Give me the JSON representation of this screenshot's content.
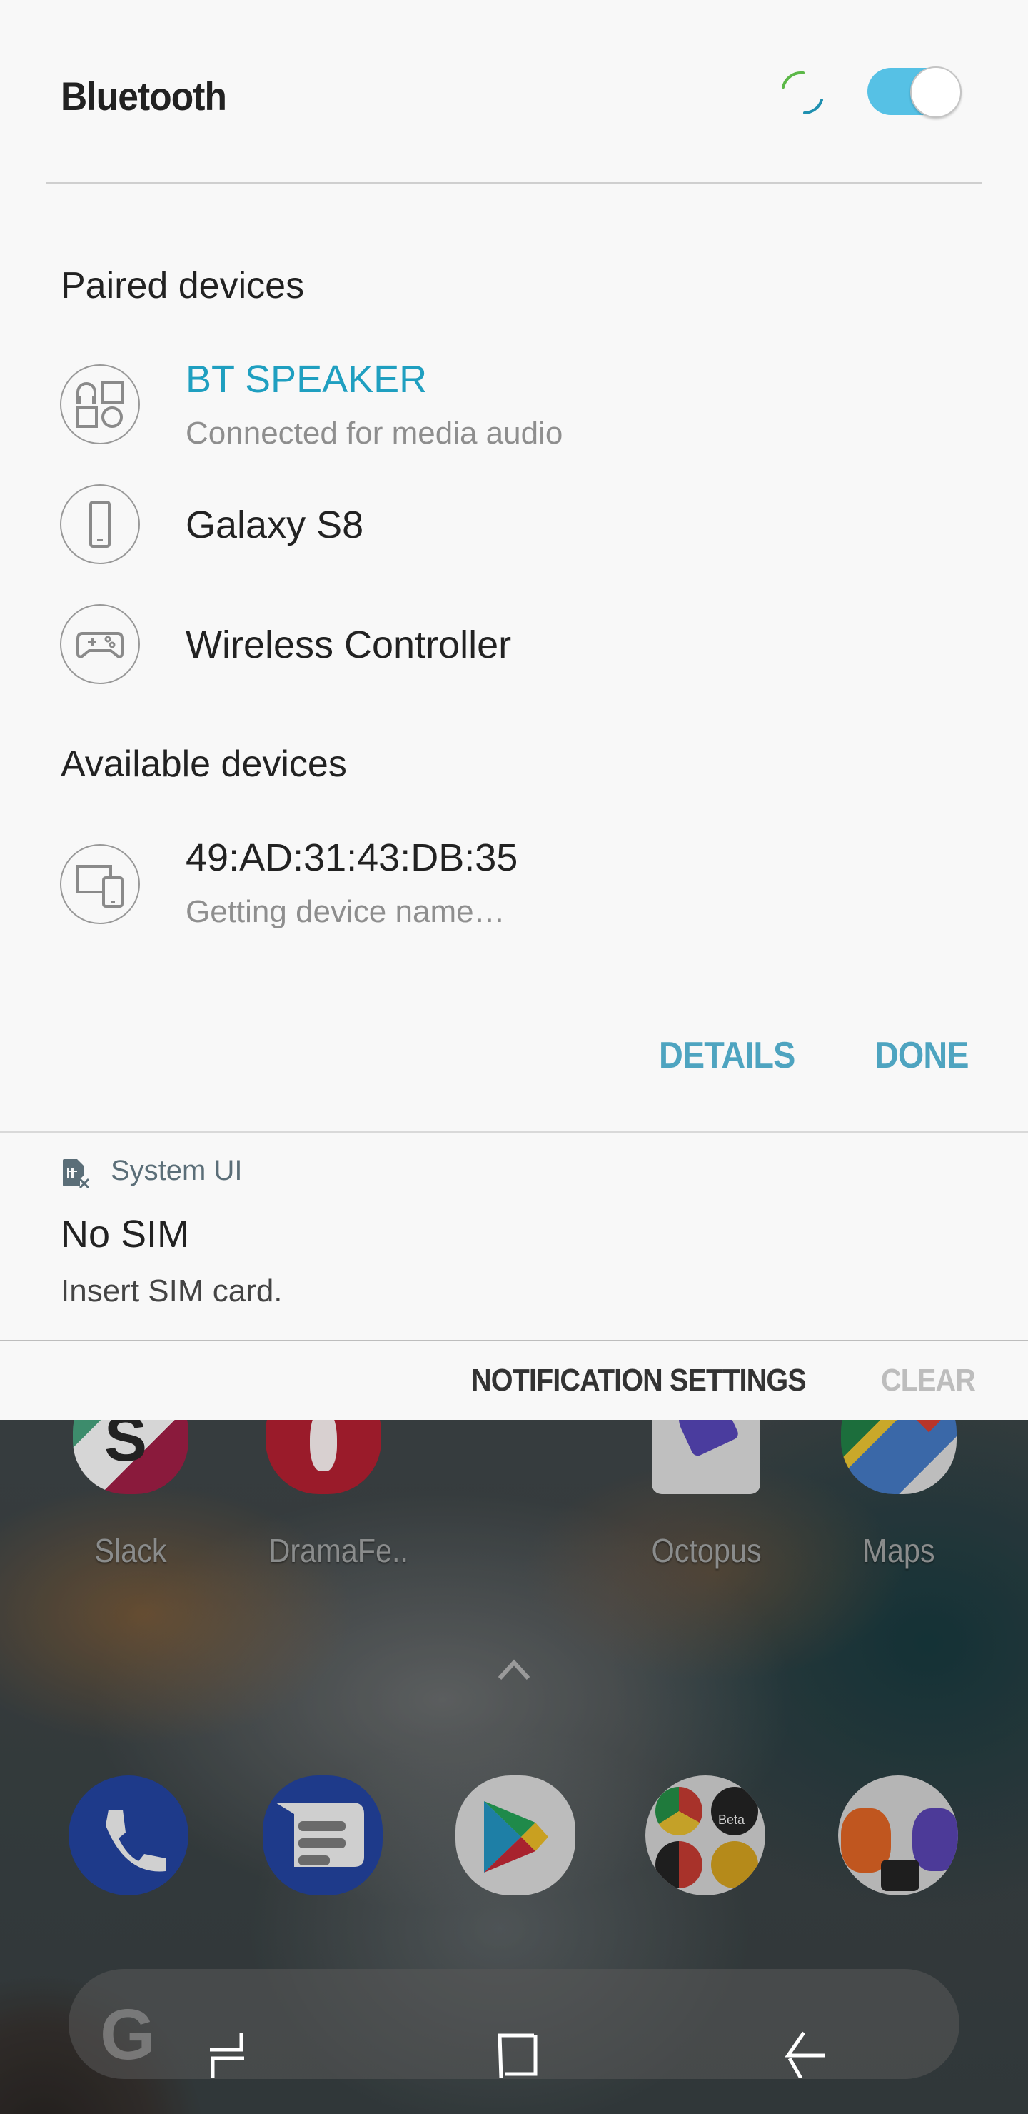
{
  "bluetooth_panel": {
    "title": "Bluetooth",
    "toggle_on": true,
    "scanning": true,
    "accent_color": "#1f9fc0",
    "paired_label": "Paired devices",
    "paired_devices": [
      {
        "name": "BT SPEAKER",
        "status": "Connected for media audio",
        "icon": "headphones-speaker-icon",
        "connected": true
      },
      {
        "name": "Galaxy S8",
        "status": "",
        "icon": "phone-icon",
        "connected": false
      },
      {
        "name": "Wireless Controller",
        "status": "",
        "icon": "gamepad-icon",
        "connected": false
      }
    ],
    "available_label": "Available devices",
    "available_devices": [
      {
        "name": "49:AD:31:43:DB:35",
        "status": "Getting device name…",
        "icon": "devices-icon"
      }
    ],
    "details_label": "DETAILS",
    "done_label": "DONE"
  },
  "notification": {
    "app_name": "System UI",
    "app_icon": "sim-card-off-icon",
    "title": "No SIM",
    "text": "Insert SIM card.",
    "settings_label": "NOTIFICATION SETTINGS",
    "clear_label": "CLEAR"
  },
  "home_screen": {
    "apps": [
      {
        "label": "Slack"
      },
      {
        "label": "DramaFe.."
      },
      {
        "label": "Octopus"
      },
      {
        "label": "Maps"
      }
    ],
    "dock": [
      {
        "name": "Phone"
      },
      {
        "name": "Messages"
      },
      {
        "name": "Play Store"
      },
      {
        "name": "Chrome folder",
        "badge": "Beta"
      },
      {
        "name": "Camera folder"
      }
    ],
    "search_logo": "G"
  },
  "nav_bar": {
    "recents": "recents-icon",
    "home": "home-icon",
    "back": "back-icon"
  }
}
